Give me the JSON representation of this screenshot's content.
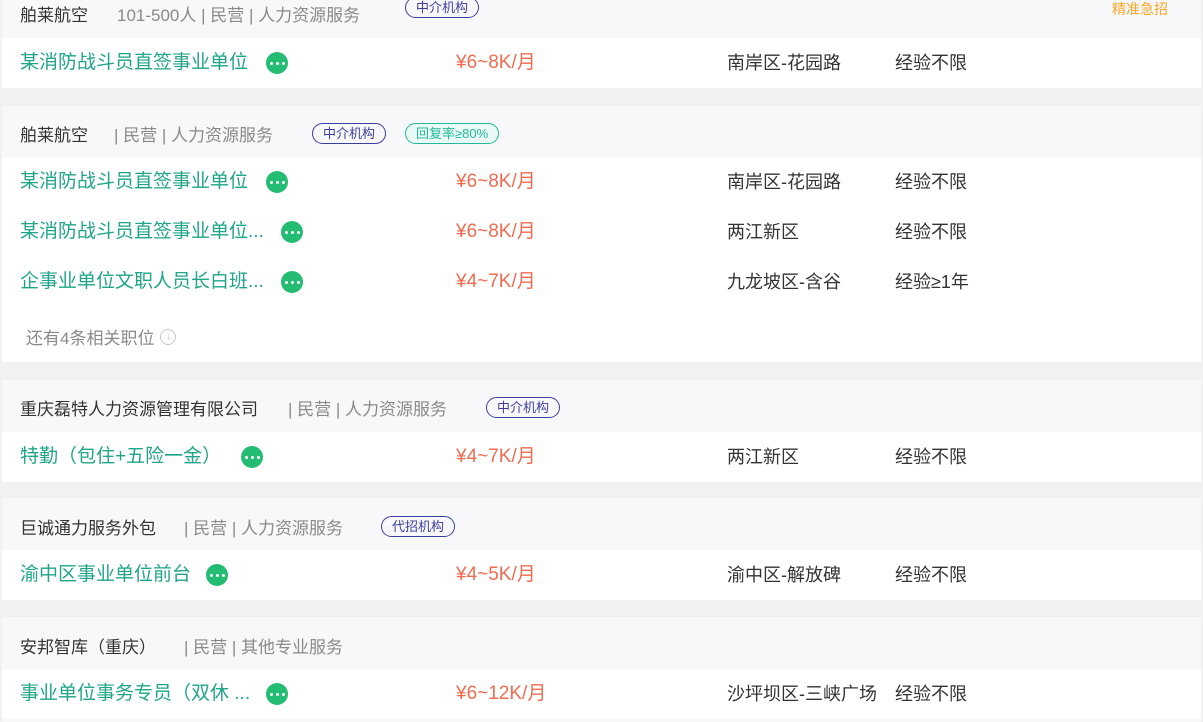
{
  "listings": [
    {
      "company": "舶莱航空",
      "meta": "101-500人 | 民营 | 人力资源服务",
      "badges": [
        "中介机构"
      ],
      "urgent": "精准急招",
      "jobs": [
        {
          "title": "某消防战斗员直签事业单位",
          "salary": "¥6~8K/月",
          "location": "南岸区-花园路",
          "experience": "经验不限"
        }
      ]
    },
    {
      "company": "舶莱航空",
      "meta": "| 民营 | 人力资源服务",
      "badges": [
        "中介机构",
        "回复率≥80%"
      ],
      "jobs": [
        {
          "title": "某消防战斗员直签事业单位",
          "salary": "¥6~8K/月",
          "location": "南岸区-花园路",
          "experience": "经验不限"
        },
        {
          "title": "某消防战斗员直签事业单位...",
          "salary": "¥6~8K/月",
          "location": "两江新区",
          "experience": "经验不限"
        },
        {
          "title": "企事业单位文职人员长白班...",
          "salary": "¥4~7K/月",
          "location": "九龙坡区-含谷",
          "experience": "经验≥1年"
        }
      ],
      "more": "还有4条相关职位"
    },
    {
      "company": "重庆磊特人力资源管理有限公司",
      "meta": "| 民营 | 人力资源服务",
      "badges": [
        "中介机构"
      ],
      "jobs": [
        {
          "title": "特勤（包住+五险一金）",
          "salary": "¥4~7K/月",
          "location": "两江新区",
          "experience": "经验不限"
        }
      ]
    },
    {
      "company": "巨诚通力服务外包",
      "meta": "| 民营 | 人力资源服务",
      "badges": [
        "代招机构"
      ],
      "jobs": [
        {
          "title": "渝中区事业单位前台",
          "salary": "¥4~5K/月",
          "location": "渝中区-解放碑",
          "experience": "经验不限"
        }
      ]
    },
    {
      "company": "安邦智库（重庆）",
      "meta": "| 民营 | 其他专业服务",
      "badges": [],
      "jobs": [
        {
          "title": "事业单位事务专员（双休 ...",
          "salary": "¥6~12K/月",
          "location": "沙坪坝区-三峡广场",
          "experience": "经验不限"
        }
      ]
    }
  ],
  "colors": {
    "title": "#1fa58a",
    "salary": "#f26b4f",
    "agency_badge": "#3d3fa0",
    "reply_badge": "#21b99a",
    "urgent": "#f5a623",
    "chat_icon": "#24bc72"
  }
}
